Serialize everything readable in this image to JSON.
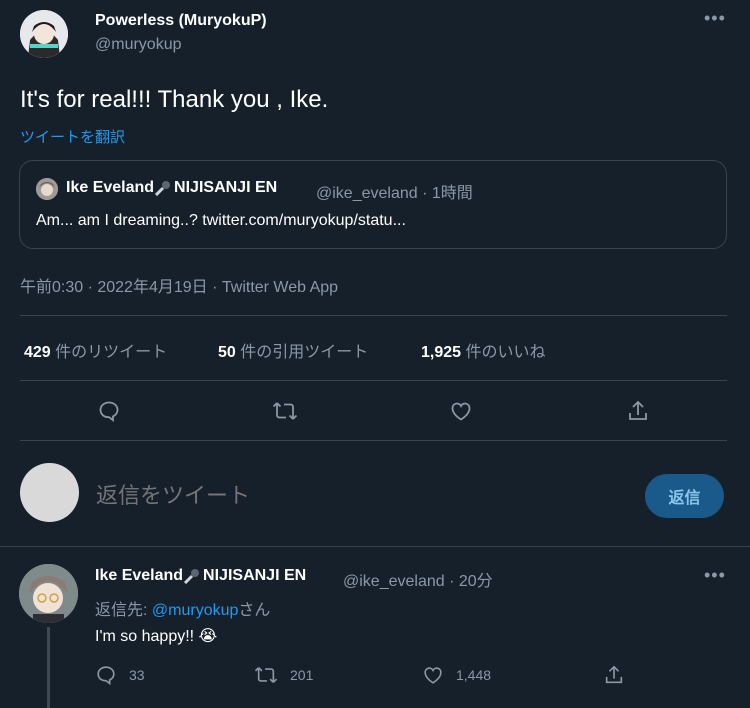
{
  "tweet": {
    "author_name": "Powerless (MuryokuP)",
    "author_handle": "@muryokup",
    "text": "It's for real!!! Thank you , Ike.",
    "translate_label": "ツイートを翻訳",
    "meta": "午前0:30 · 2022年4月19日 · Twitter Web App",
    "more_icon": "more-icon"
  },
  "quote": {
    "name": "Ike Eveland",
    "name_suffix": "NIJISANJI EN",
    "handle_time": "@ike_eveland · 1時間",
    "text": "Am... am I dreaming..? twitter.com/muryokup/statu..."
  },
  "stats": {
    "retweets": "429",
    "retweets_label": "件のリツイート",
    "quotes": "50",
    "quotes_label": "件の引用ツイート",
    "likes": "1,925",
    "likes_label": "件のいいね"
  },
  "compose": {
    "placeholder": "返信をツイート",
    "button_label": "返信"
  },
  "reply": {
    "name": "Ike Eveland",
    "name_suffix": "NIJISANJI EN",
    "handle_time": "@ike_eveland · 20分",
    "reply_prefix": "返信先: ",
    "reply_to": "@muryokup",
    "reply_suffix": "さん",
    "text": "I'm so happy!! ",
    "emoji": "😭",
    "reply_count": "33",
    "retweet_count": "201",
    "like_count": "1,448"
  },
  "colors": {
    "background": "#15202b",
    "accent": "#1d9bf0",
    "secondary_text": "#8b98a5",
    "border": "#38444d"
  }
}
